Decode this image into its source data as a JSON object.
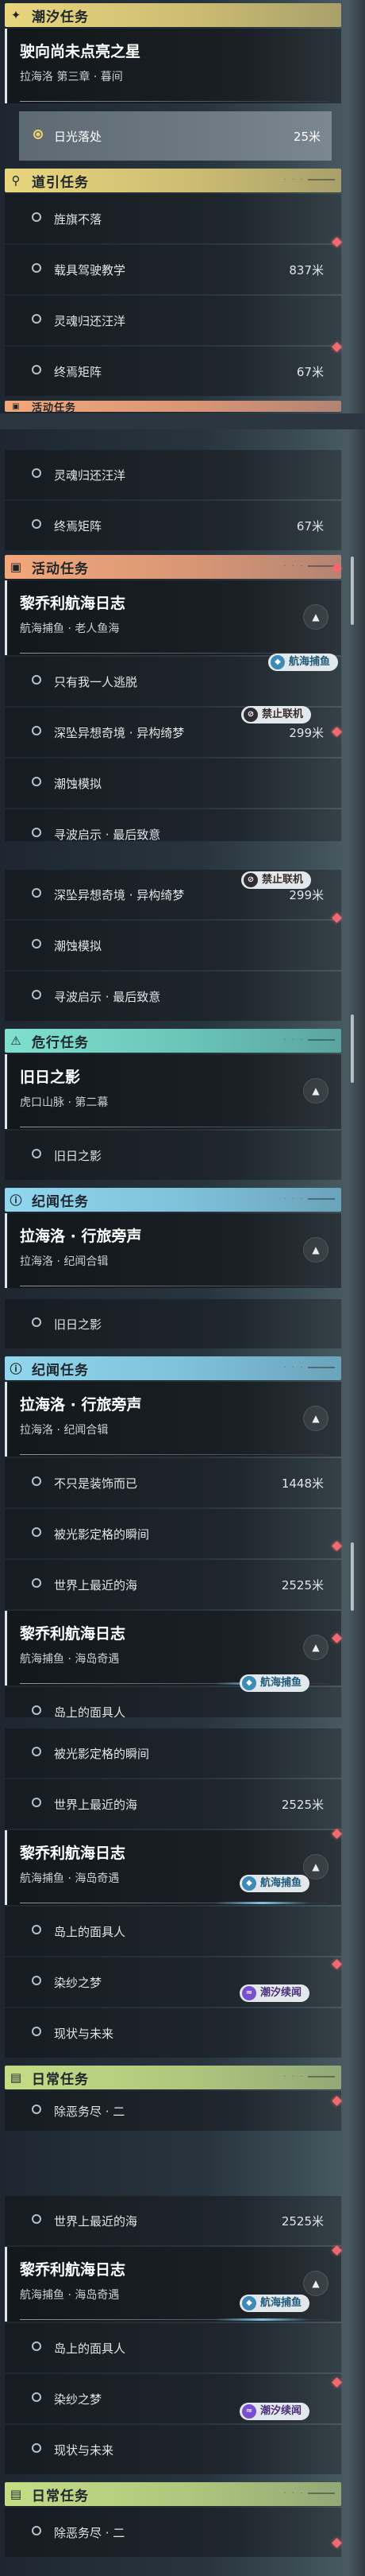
{
  "units": {
    "meters": "米"
  },
  "sections": {
    "chaoxi": "潮汐任务",
    "daoyin": "道引任务",
    "huodong": "活动任务",
    "weixing": "危行任务",
    "jiwen": "纪闻任务",
    "richang": "日常任务"
  },
  "header_deco_text": "· · ·",
  "groups": {
    "g1": {
      "title": "驶向尚未点亮之星",
      "subtitle": "拉海洛 第三章 · 暮间"
    },
    "g2": {
      "title": "黎乔利航海日志",
      "subtitle": "航海捕鱼 · 老人鱼海"
    },
    "g3": {
      "title": "旧日之影",
      "subtitle": "虎口山脉 · 第二幕"
    },
    "g4": {
      "title": "拉海洛 · 行旅旁声",
      "subtitle": "拉海洛 · 纪闻合辑"
    },
    "g5": {
      "title": "黎乔利航海日志",
      "subtitle": "航海捕鱼 · 海岛奇遇"
    }
  },
  "items": {
    "rigguang": {
      "text": "日光落处",
      "distance": "25米"
    },
    "qijuan": {
      "text": "旌旗不落"
    },
    "zaiju": {
      "text": "载具驾驶教学",
      "distance": "837米"
    },
    "linghun": {
      "text": "灵魂归还汪洋"
    },
    "zhongyan": {
      "text": "终焉矩阵",
      "distance": "67米"
    },
    "zhiyou": {
      "text": "只有我一人逃脱"
    },
    "shenyuan": {
      "text": "深坠异想奇境 · 异构绮梦",
      "distance": "299米"
    },
    "chaoshi": {
      "text": "潮蚀模拟"
    },
    "xunbo": {
      "text": "寻波启示 · 最后致意"
    },
    "jiuri": {
      "text": "旧日之影"
    },
    "bushi": {
      "text": "不只是装饰而已",
      "distance": "1448米"
    },
    "beiguang": {
      "text": "被光影定格的瞬间"
    },
    "shijie": {
      "text": "世界上最近的海",
      "distance": "2525米"
    },
    "daoshang": {
      "text": "岛上的面具人"
    },
    "ransha": {
      "text": "染纱之梦"
    },
    "xianzhuang": {
      "text": "现状与未来"
    },
    "chuegou": {
      "text": "除恶务尽 · 二"
    }
  },
  "tags": {
    "sea": "航海捕鱼",
    "ban": "禁止联机",
    "tide": "潮汐续闻"
  },
  "icons": {
    "chaoxi": "star-diamond-icon",
    "daoyin": "location-pin-icon",
    "huodong": "event-icon",
    "weixing": "danger-icon",
    "jiwen": "info-icon",
    "richang": "calendar-icon",
    "collapse": "chevron-up-icon"
  },
  "colors": {
    "chaoxi": "#e8d57d",
    "daoyin": "#e8d57d",
    "huodong": "#f2a77a",
    "weixing": "#7fe0cf",
    "jiwen": "#91d7ee",
    "richang": "#c3dd86",
    "marker": "#f06a70"
  }
}
